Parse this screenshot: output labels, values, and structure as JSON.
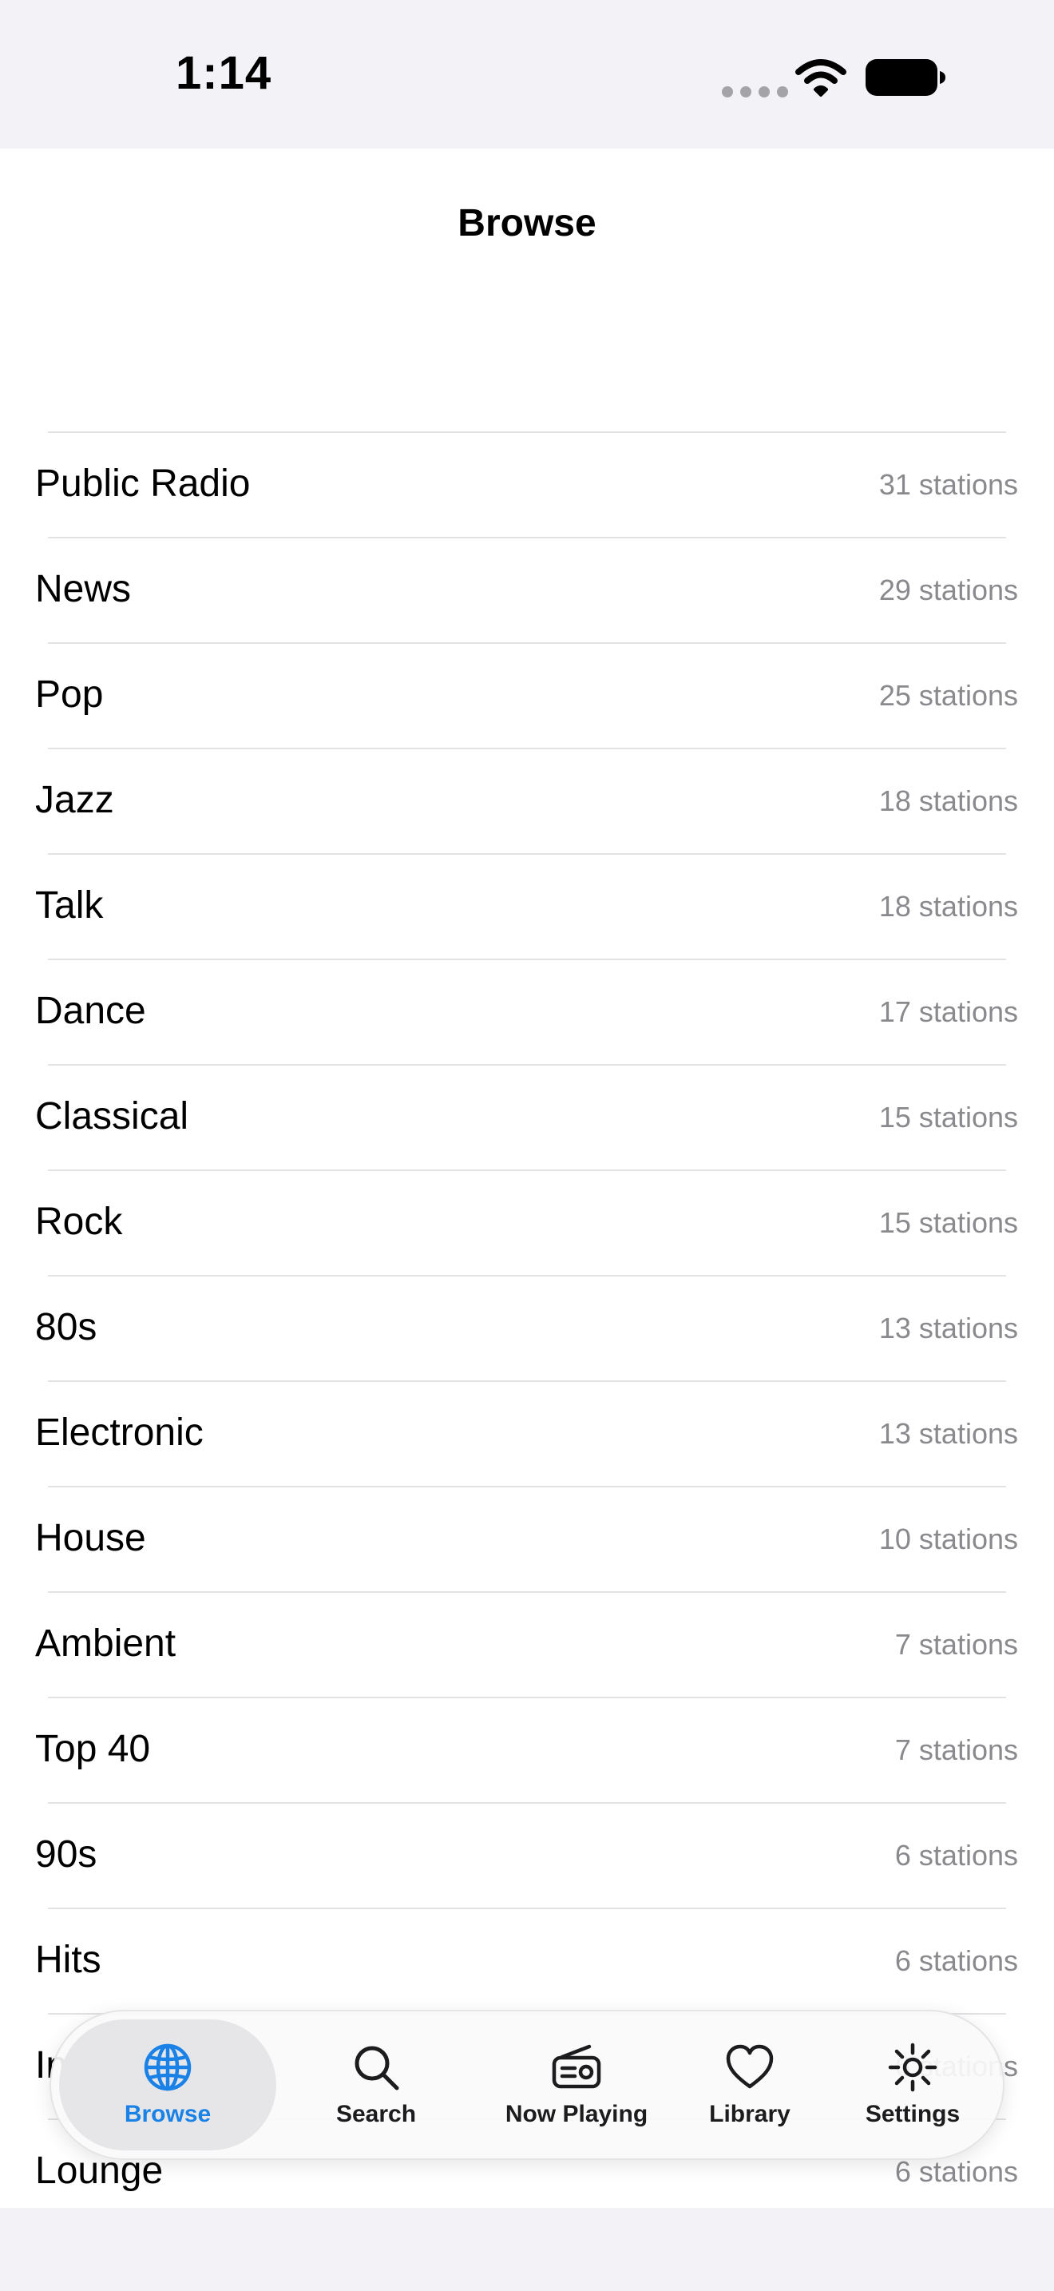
{
  "status_bar": {
    "time": "1:14"
  },
  "header": {
    "title": "Browse"
  },
  "genres": [
    {
      "name": "Public Radio",
      "count": "31 stations"
    },
    {
      "name": "News",
      "count": "29 stations"
    },
    {
      "name": "Pop",
      "count": "25 stations"
    },
    {
      "name": "Jazz",
      "count": "18 stations"
    },
    {
      "name": "Talk",
      "count": "18 stations"
    },
    {
      "name": "Dance",
      "count": "17 stations"
    },
    {
      "name": "Classical",
      "count": "15 stations"
    },
    {
      "name": "Rock",
      "count": "15 stations"
    },
    {
      "name": "80s",
      "count": "13 stations"
    },
    {
      "name": "Electronic",
      "count": "13 stations"
    },
    {
      "name": "House",
      "count": "10 stations"
    },
    {
      "name": "Ambient",
      "count": "7 stations"
    },
    {
      "name": "Top 40",
      "count": "7 stations"
    },
    {
      "name": "90s",
      "count": "6 stations"
    },
    {
      "name": "Hits",
      "count": "6 stations"
    },
    {
      "name": "Indie",
      "count": "6 stations"
    },
    {
      "name": "Lounge",
      "count": "6 stations"
    }
  ],
  "tab_bar": {
    "accent_color": "#1a82e6",
    "tabs": [
      {
        "label": "Browse",
        "icon": "globe-icon",
        "active": true
      },
      {
        "label": "Search",
        "icon": "magnifier-icon",
        "active": false
      },
      {
        "label": "Now Playing",
        "icon": "radio-icon",
        "active": false
      },
      {
        "label": "Library",
        "icon": "heart-icon",
        "active": false
      },
      {
        "label": "Settings",
        "icon": "gear-icon",
        "active": false
      }
    ]
  }
}
